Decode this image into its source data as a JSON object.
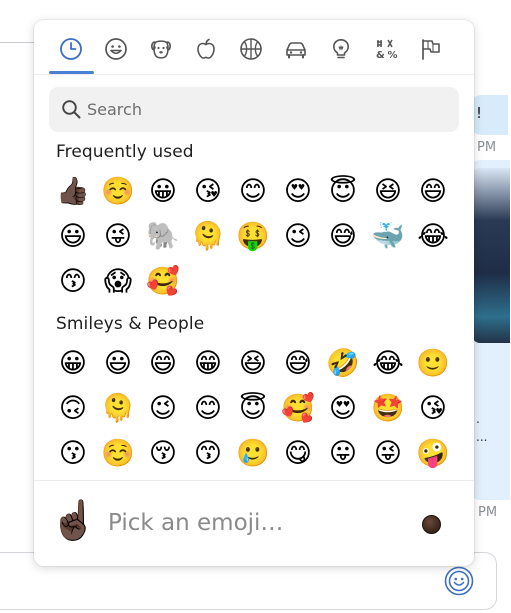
{
  "background": {
    "bubble_text": "!",
    "time_top": "PM",
    "time_bottom": "PM",
    "card_dots": [
      ".",
      "..."
    ]
  },
  "picker": {
    "categories": [
      {
        "id": "recent",
        "icon": "clock-icon",
        "active": true
      },
      {
        "id": "smileys",
        "icon": "smiley-icon",
        "active": false
      },
      {
        "id": "animals",
        "icon": "dog-icon",
        "active": false
      },
      {
        "id": "food",
        "icon": "apple-icon",
        "active": false
      },
      {
        "id": "activity",
        "icon": "basketball-icon",
        "active": false
      },
      {
        "id": "travel",
        "icon": "car-icon",
        "active": false
      },
      {
        "id": "objects",
        "icon": "lightbulb-icon",
        "active": false
      },
      {
        "id": "symbols",
        "icon": "symbols-icon",
        "active": false
      },
      {
        "id": "flags",
        "icon": "flags-icon",
        "active": false
      }
    ],
    "accent_color": "#4a7fd6",
    "search": {
      "placeholder": "Search",
      "value": ""
    },
    "sections": {
      "frequent_title": "Frequently used",
      "people_title": "Smileys & People"
    },
    "frequent": [
      "👍🏿",
      "☺️",
      "😀",
      "😘",
      "😊",
      "😍",
      "😇",
      "😆",
      "😄",
      "😃",
      "😜",
      "🐘",
      "🫠",
      "🤑",
      "😉",
      "😅",
      "🐳",
      "😂",
      "😙",
      "😱",
      "🥰"
    ],
    "smileys": [
      "😀",
      "😃",
      "😄",
      "😁",
      "😆",
      "😅",
      "🤣",
      "😂",
      "🙂",
      "🙃",
      "🫠",
      "😉",
      "😊",
      "😇",
      "🥰",
      "😍",
      "🤩",
      "😘",
      "😗",
      "☺️",
      "😚",
      "😙",
      "🥲",
      "😋",
      "😛",
      "😜",
      "🤪"
    ],
    "footer": {
      "preview_emoji": "☝🏿",
      "pick_text": "Pick an emoji…",
      "skin_tone_color": "#3e2a1f"
    }
  },
  "composer": {
    "emoji_button_icon": "smiley-icon"
  }
}
